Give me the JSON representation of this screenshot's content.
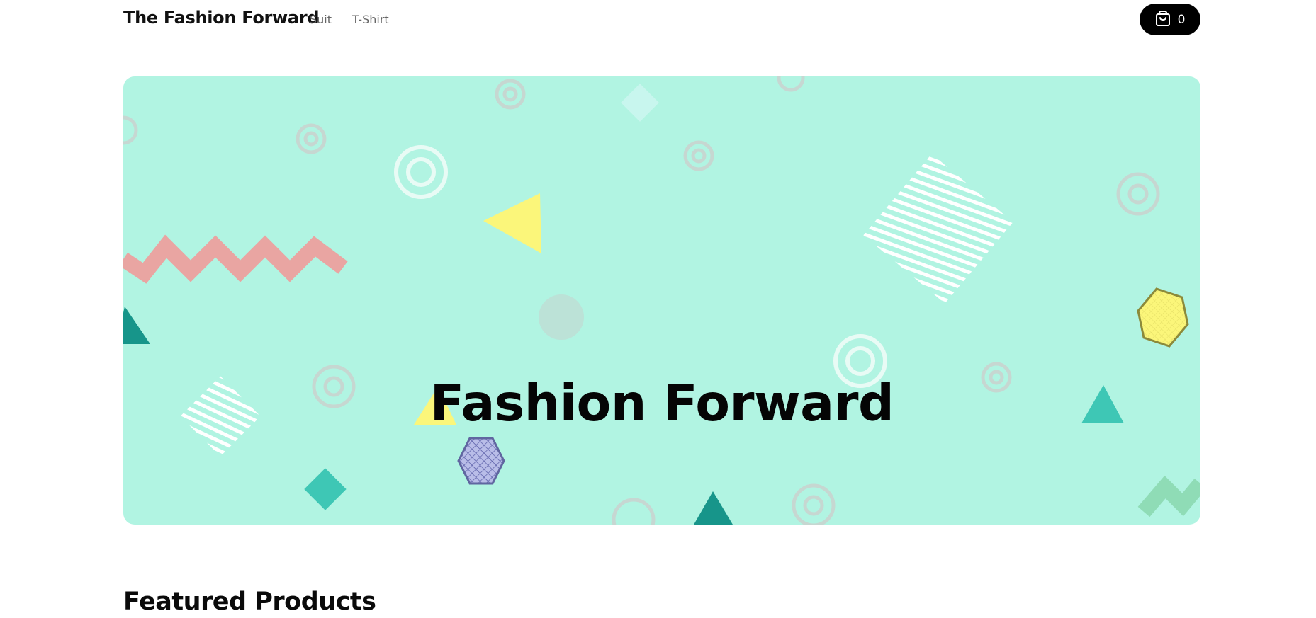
{
  "nav": {
    "brand": "The Fashion Forward",
    "links": [
      {
        "label": "Suit"
      },
      {
        "label": "T-Shirt"
      }
    ],
    "cart": {
      "count": "0",
      "icon": "shopping-bag-icon"
    }
  },
  "hero": {
    "title": "Fashion Forward",
    "background_color": "#b1f4e2"
  },
  "featured": {
    "title": "Featured Products"
  },
  "colors": {
    "brand_black": "#000000",
    "hero_mint": "#b1f4e2",
    "accent_yellow": "#fbf67a",
    "accent_teal": "#3ec7b5",
    "accent_pink": "#e9a5a2"
  }
}
